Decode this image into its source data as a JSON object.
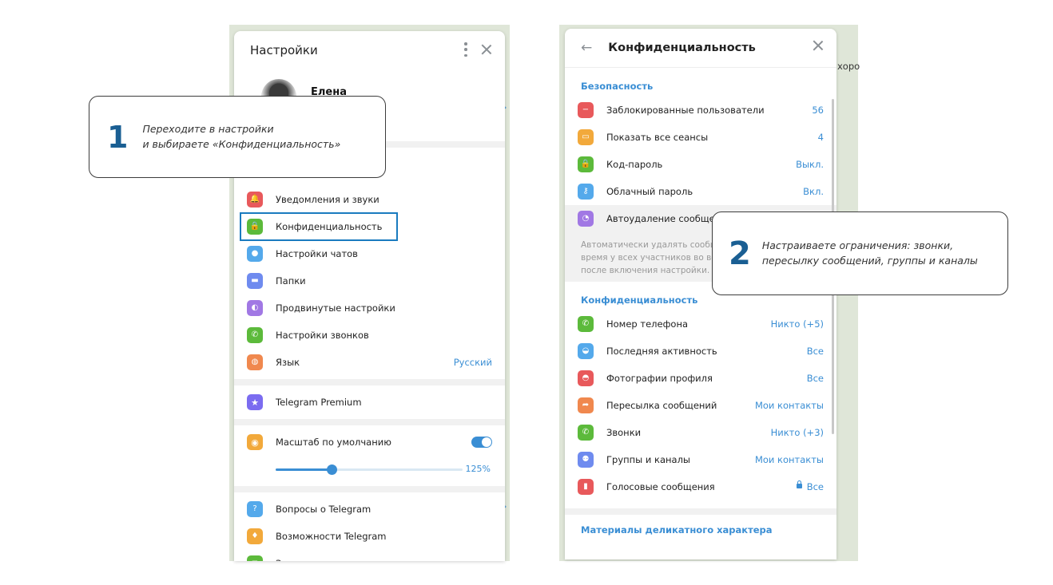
{
  "settings": {
    "title": "Настройки",
    "profile_name": "Елена",
    "items_group1": [
      {
        "label": "Уведомления и звуки",
        "icon": "bell-icon",
        "color": "#e8595b"
      },
      {
        "label": "Конфиденциальность",
        "icon": "lock-icon",
        "color": "#5cba3b"
      },
      {
        "label": "Настройки чатов",
        "icon": "chat-bubble-icon",
        "color": "#54a9eb"
      },
      {
        "label": "Папки",
        "icon": "folder-icon",
        "color": "#6f8bef"
      },
      {
        "label": "Продвинутые настройки",
        "icon": "pie-chart-icon",
        "color": "#a178e4"
      },
      {
        "label": "Настройки звонков",
        "icon": "phone-icon",
        "color": "#5cba3b"
      },
      {
        "label": "Язык",
        "icon": "globe-icon",
        "color": "#f0884e",
        "value": "Русский"
      }
    ],
    "premium_label": "Telegram Premium",
    "scale_label": "Масштаб по умолчанию",
    "scale_value": "125%",
    "scale_fraction": 0.3,
    "items_group3": [
      {
        "label": "Вопросы о Telegram",
        "icon": "question-icon",
        "color": "#54a9eb"
      },
      {
        "label": "Возможности Telegram",
        "icon": "lightbulb-icon",
        "color": "#f2a93b"
      },
      {
        "label": "Задать вопрос",
        "icon": "chat-dots-icon",
        "color": "#5cba3b"
      }
    ]
  },
  "privacy": {
    "title": "Конфиденциальность",
    "security_title": "Безопасность",
    "security_items": [
      {
        "label": "Заблокированные пользователи",
        "value": "56",
        "icon": "block-icon",
        "color": "#e8595b"
      },
      {
        "label": "Показать все сеансы",
        "value": "4",
        "icon": "laptop-icon",
        "color": "#f2a93b"
      },
      {
        "label": "Код-пароль",
        "value": "Выкл.",
        "icon": "lock-icon",
        "color": "#5cba3b"
      },
      {
        "label": "Облачный пароль",
        "value": "Вкл.",
        "icon": "key-icon",
        "color": "#54a9eb"
      },
      {
        "label": "Автоудаление сообще",
        "value": "",
        "icon": "timer-icon",
        "color": "#a178e4"
      }
    ],
    "note_lines": [
      "Автоматически удалять сообщ",
      "время у всех участников во вс",
      "после включения настройки."
    ],
    "privacy_title": "Конфиденциальность",
    "privacy_items": [
      {
        "label": "Номер телефона",
        "value": "Никто (+5)",
        "icon": "phone-icon",
        "color": "#5cba3b"
      },
      {
        "label": "Последняя активность",
        "value": "Все",
        "icon": "user-clock-icon",
        "color": "#54a9eb"
      },
      {
        "label": "Фотографии профиля",
        "value": "Все",
        "icon": "user-photo-icon",
        "color": "#e8595b"
      },
      {
        "label": "Пересылка сообщений",
        "value": "Мои контакты",
        "icon": "forward-icon",
        "color": "#f0884e"
      },
      {
        "label": "Звонки",
        "value": "Никто (+3)",
        "icon": "call-icon",
        "color": "#5cba3b"
      },
      {
        "label": "Группы и каналы",
        "value": "Мои контакты",
        "icon": "group-icon",
        "color": "#6f8bef"
      },
      {
        "label": "Голосовые сообщения",
        "value": "Все",
        "icon": "microphone-icon",
        "color": "#e8595b"
      }
    ],
    "sensitive_title": "Материалы деликатного характера"
  },
  "callouts": {
    "one": {
      "number": "1",
      "line1": "Переходите в настройки",
      "line2": "и выбираете «Конфиденциальность»"
    },
    "two": {
      "number": "2",
      "line1": "Настраиваете ограничения: звонки,",
      "line2": "пересылку сообщений, группы и каналы"
    }
  },
  "background_fragments": {
    "right_edge_text": "хоро"
  }
}
